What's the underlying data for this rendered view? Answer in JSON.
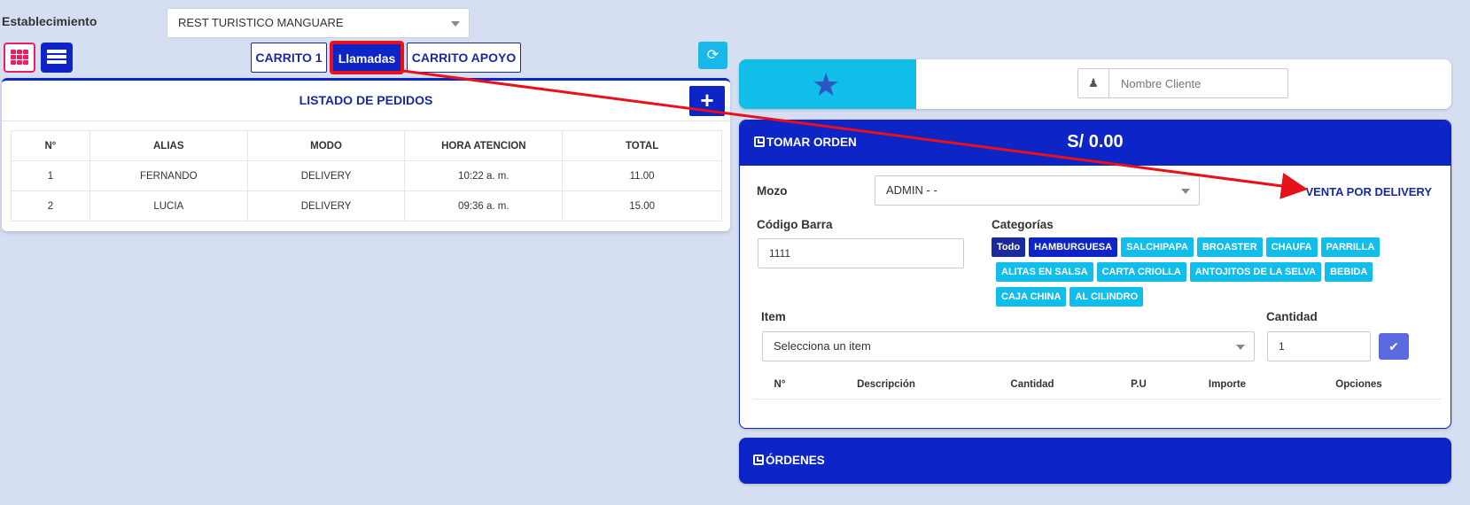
{
  "establecimiento": {
    "label": "Establecimiento",
    "value": "REST TURISTICO MANGUARE"
  },
  "tabs": [
    {
      "label": "CARRITO 1"
    },
    {
      "label": "Llamadas"
    },
    {
      "label": "CARRITO APOYO"
    }
  ],
  "orders": {
    "title": "LISTADO DE PEDIDOS",
    "add_label": "+",
    "columns": [
      "N°",
      "ALIAS",
      "MODO",
      "HORA ATENCION",
      "TOTAL"
    ],
    "rows": [
      [
        "1",
        "FERNANDO",
        "DELIVERY",
        "10:22 a. m.",
        "11.00"
      ],
      [
        "2",
        "LUCIA",
        "DELIVERY",
        "09:36 a. m.",
        "15.00"
      ]
    ]
  },
  "client": {
    "placeholder": "Nombre Cliente"
  },
  "order": {
    "title": "TOMAR ORDEN",
    "total": "S/ 0.00",
    "mozo_label": "Mozo",
    "mozo_value": "ADMIN - -",
    "delivery_link": "VENTA POR DELIVERY",
    "barcode_label": "Código Barra",
    "barcode_value": "1111",
    "categories_label": "Categorías",
    "categories_row1": [
      "Todo",
      "HAMBURGUESA",
      "SALCHIPAPA",
      "BROASTER",
      "CHAUFA",
      "PARRILLA"
    ],
    "categories_row2": [
      "ALITAS EN SALSA",
      "CARTA CRIOLLA",
      "ANTOJITOS DE LA SELVA",
      "BEBIDA"
    ],
    "categories_row3": [
      "CAJA CHINA",
      "AL CILINDRO"
    ],
    "item_label": "Item",
    "item_placeholder": "Selecciona un item",
    "qty_label": "Cantidad",
    "qty_value": "1",
    "table_columns": [
      "N°",
      "Descripción",
      "Cantidad",
      "P.U",
      "Importe",
      "Opciones"
    ]
  },
  "ordenes": {
    "title": "ÓRDENES"
  },
  "colors": {
    "primary": "#0d25c7",
    "accent": "#11bde9",
    "pink": "#e91e63",
    "arrow": "#e8101a"
  },
  "icons": [
    "grid-view-icon",
    "list-view-icon",
    "refresh-icon",
    "star-icon",
    "user-icon",
    "check-icon",
    "order-box-icon"
  ]
}
